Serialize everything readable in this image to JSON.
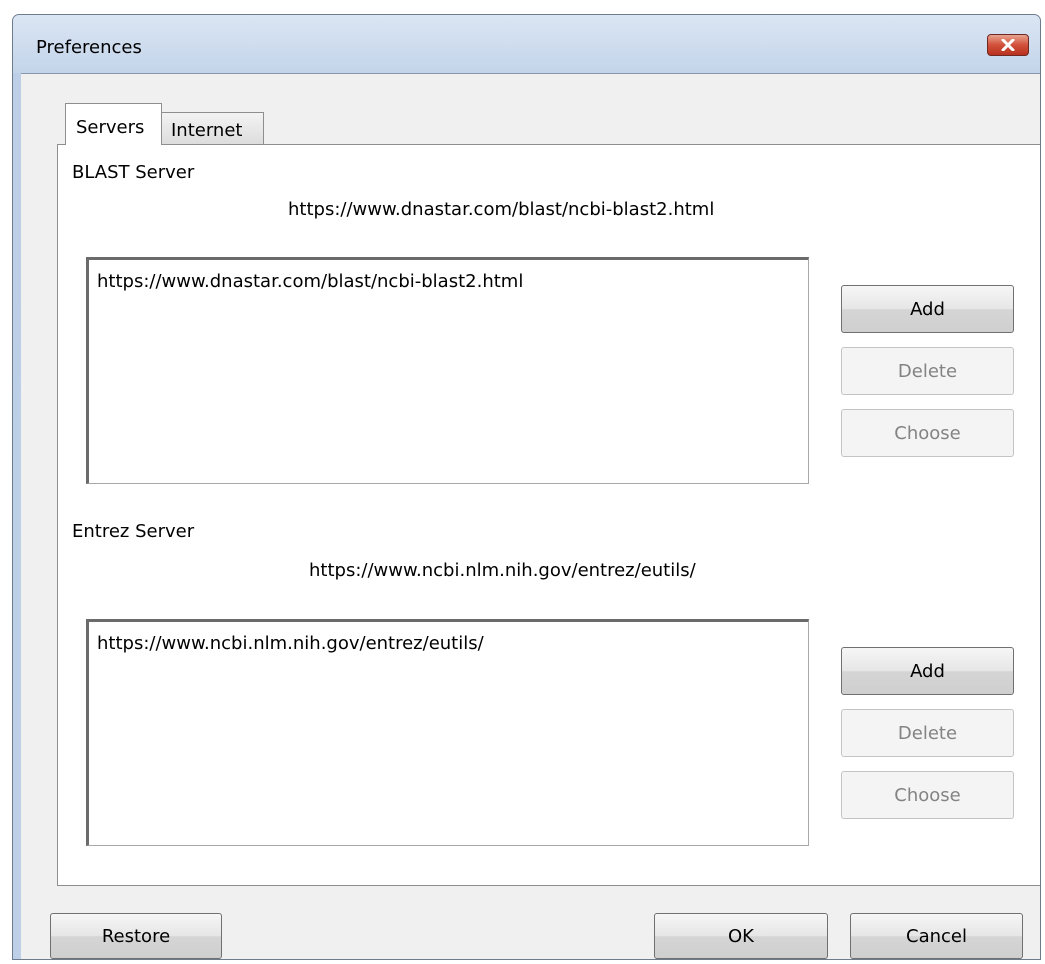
{
  "window": {
    "title": "Preferences"
  },
  "tabs": [
    "Servers",
    "Internet"
  ],
  "blast": {
    "heading": "BLAST Server",
    "current": "https://www.dnastar.com/blast/ncbi-blast2.html",
    "items": [
      "https://www.dnastar.com/blast/ncbi-blast2.html"
    ],
    "add": "Add",
    "delete": "Delete",
    "choose": "Choose"
  },
  "entrez": {
    "heading": "Entrez Server",
    "current": "https://www.ncbi.nlm.nih.gov/entrez/eutils/",
    "items": [
      "https://www.ncbi.nlm.nih.gov/entrez/eutils/"
    ],
    "add": "Add",
    "delete": "Delete",
    "choose": "Choose"
  },
  "footer": {
    "restore": "Restore",
    "ok": "OK",
    "cancel": "Cancel"
  },
  "icons": {
    "close": "close-icon"
  },
  "colors": {
    "close_button": "#c9432f",
    "title_bar": "#c3d4ea"
  }
}
